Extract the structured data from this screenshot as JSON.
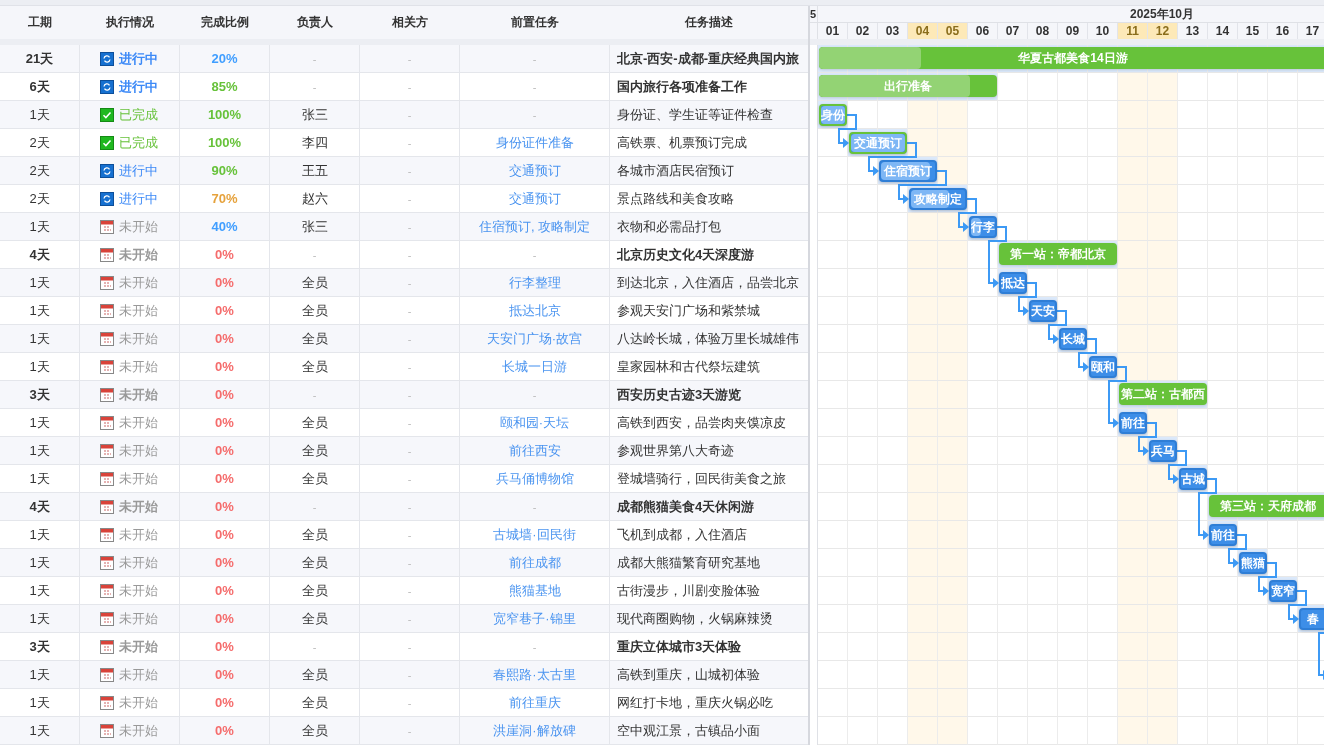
{
  "table": {
    "columns": [
      "工期",
      "执行情况",
      "完成比例",
      "负责人",
      "相关方",
      "前置任务",
      "任务描述"
    ],
    "rows": [
      {
        "kind": "summary",
        "duration": "21天",
        "status": {
          "kind": "in_progress",
          "label": "进行中"
        },
        "progress": {
          "text": "20%",
          "color": "#409eff"
        },
        "owner": "-",
        "stakeholder": "-",
        "predecessor": "-",
        "description": "北京-西安-成都-重庆经典国内旅",
        "bar": {
          "kind": "summary",
          "days": [
            true,
            true,
            true,
            true,
            true,
            true,
            true,
            true,
            true,
            true,
            true,
            true,
            true,
            true,
            true,
            true,
            true
          ],
          "label": "华夏古都美食14日游",
          "level": 0.2
        }
      },
      {
        "kind": "summary",
        "duration": "6天",
        "status": {
          "kind": "in_progress",
          "label": "进行中"
        },
        "progress": {
          "text": "85%",
          "color": "#67c23a"
        },
        "owner": "-",
        "stakeholder": "-",
        "predecessor": "-",
        "description": "国内旅行各项准备工作",
        "bar": {
          "kind": "summary",
          "days": [
            true,
            true,
            true,
            true,
            true,
            true,
            false,
            false,
            false,
            false,
            false,
            false,
            false,
            false,
            false,
            false,
            false
          ],
          "label": "出行准备",
          "level": 0.85
        }
      },
      {
        "kind": "task",
        "duration": "1天",
        "status": {
          "kind": "done",
          "label": "已完成"
        },
        "progress": {
          "text": "100%",
          "color": "#67c23a"
        },
        "owner": "张三",
        "stakeholder": "-",
        "predecessor": "-",
        "description": "身份证、学生证等证件检查",
        "bar": {
          "kind": "task",
          "days": [
            true,
            false,
            false,
            false,
            false,
            false,
            false,
            false,
            false,
            false,
            false,
            false,
            false,
            false,
            false,
            false,
            false
          ],
          "label": "身份",
          "level": 1,
          "linked": false
        }
      },
      {
        "kind": "task",
        "duration": "2天",
        "status": {
          "kind": "done",
          "label": "已完成"
        },
        "progress": {
          "text": "100%",
          "color": "#67c23a"
        },
        "owner": "李四",
        "stakeholder": "-",
        "predecessor": "身份证件准备",
        "description": "高铁票、机票预订完成",
        "bar": {
          "kind": "task",
          "days": [
            false,
            true,
            true,
            false,
            false,
            false,
            false,
            false,
            false,
            false,
            false,
            false,
            false,
            false,
            false,
            false,
            false
          ],
          "label": "交通预订",
          "level": 1,
          "linked": true
        }
      },
      {
        "kind": "task",
        "duration": "2天",
        "status": {
          "kind": "in_progress",
          "label": "进行中"
        },
        "progress": {
          "text": "90%",
          "color": "#67c23a"
        },
        "owner": "王五",
        "stakeholder": "-",
        "predecessor": "交通预订",
        "description": "各城市酒店民宿预订",
        "bar": {
          "kind": "task",
          "days": [
            false,
            false,
            true,
            true,
            false,
            false,
            false,
            false,
            false,
            false,
            false,
            false,
            false,
            false,
            false,
            false,
            false
          ],
          "label": "住宿预订",
          "level": 0.9,
          "linked": true
        }
      },
      {
        "kind": "task",
        "duration": "2天",
        "status": {
          "kind": "in_progress",
          "label": "进行中"
        },
        "progress": {
          "text": "70%",
          "color": "#e6a23c"
        },
        "owner": "赵六",
        "stakeholder": "-",
        "predecessor": "交通预订",
        "description": "景点路线和美食攻略",
        "bar": {
          "kind": "task",
          "days": [
            false,
            false,
            false,
            true,
            true,
            false,
            false,
            false,
            false,
            false,
            false,
            false,
            false,
            false,
            false,
            false,
            false
          ],
          "label": "攻略制定",
          "level": 0.7,
          "linked": true
        }
      },
      {
        "kind": "task",
        "duration": "1天",
        "status": {
          "kind": "not_started",
          "label": "未开始"
        },
        "progress": {
          "text": "40%",
          "color": "#409eff"
        },
        "owner": "张三",
        "stakeholder": "-",
        "predecessor": "住宿预订, 攻略制定",
        "description": "衣物和必需品打包",
        "bar": {
          "kind": "task",
          "days": [
            false,
            false,
            false,
            false,
            false,
            true,
            false,
            false,
            false,
            false,
            false,
            false,
            false,
            false,
            false,
            false,
            false
          ],
          "label": "行李",
          "level": 0.4,
          "linked": true
        }
      },
      {
        "kind": "summary",
        "duration": "4天",
        "status": {
          "kind": "not_started",
          "label": "未开始"
        },
        "progress": {
          "text": "0%",
          "color": "#f56c6c"
        },
        "owner": "-",
        "stakeholder": "-",
        "predecessor": "-",
        "description": "北京历史文化4天深度游",
        "bar": {
          "kind": "summary",
          "days": [
            false,
            false,
            false,
            false,
            false,
            false,
            true,
            true,
            true,
            true,
            false,
            false,
            false,
            false,
            false,
            false,
            false
          ],
          "label": "第一站：帝都北京"
        }
      },
      {
        "kind": "task",
        "duration": "1天",
        "status": {
          "kind": "not_started",
          "label": "未开始"
        },
        "progress": {
          "text": "0%",
          "color": "#f56c6c"
        },
        "owner": "全员",
        "stakeholder": "-",
        "predecessor": "行李整理",
        "description": "到达北京，入住酒店，品尝北京",
        "bar": {
          "kind": "task",
          "days": [
            false,
            false,
            false,
            false,
            false,
            false,
            true,
            false,
            false,
            false,
            false,
            false,
            false,
            false,
            false,
            false,
            false
          ],
          "label": "抵达",
          "linked": true
        }
      },
      {
        "kind": "task",
        "duration": "1天",
        "status": {
          "kind": "not_started",
          "label": "未开始"
        },
        "progress": {
          "text": "0%",
          "color": "#f56c6c"
        },
        "owner": "全员",
        "stakeholder": "-",
        "predecessor": "抵达北京",
        "description": "参观天安门广场和紫禁城",
        "bar": {
          "kind": "task",
          "days": [
            false,
            false,
            false,
            false,
            false,
            false,
            false,
            true,
            false,
            false,
            false,
            false,
            false,
            false,
            false,
            false,
            false
          ],
          "label": "天安",
          "linked": true
        }
      },
      {
        "kind": "task",
        "duration": "1天",
        "status": {
          "kind": "not_started",
          "label": "未开始"
        },
        "progress": {
          "text": "0%",
          "color": "#f56c6c"
        },
        "owner": "全员",
        "stakeholder": "-",
        "predecessor": "天安门广场·故宫",
        "description": "八达岭长城，体验万里长城雄伟",
        "bar": {
          "kind": "task",
          "days": [
            false,
            false,
            false,
            false,
            false,
            false,
            false,
            false,
            true,
            false,
            false,
            false,
            false,
            false,
            false,
            false,
            false
          ],
          "label": "长城",
          "linked": true
        }
      },
      {
        "kind": "task",
        "duration": "1天",
        "status": {
          "kind": "not_started",
          "label": "未开始"
        },
        "progress": {
          "text": "0%",
          "color": "#f56c6c"
        },
        "owner": "全员",
        "stakeholder": "-",
        "predecessor": "长城一日游",
        "description": "皇家园林和古代祭坛建筑",
        "bar": {
          "kind": "task",
          "days": [
            false,
            false,
            false,
            false,
            false,
            false,
            false,
            false,
            false,
            true,
            false,
            false,
            false,
            false,
            false,
            false,
            false
          ],
          "label": "颐和",
          "linked": true
        }
      },
      {
        "kind": "summary",
        "duration": "3天",
        "status": {
          "kind": "not_started",
          "label": "未开始"
        },
        "progress": {
          "text": "0%",
          "color": "#f56c6c"
        },
        "owner": "-",
        "stakeholder": "-",
        "predecessor": "-",
        "description": "西安历史古迹3天游览",
        "bar": {
          "kind": "summary",
          "days": [
            false,
            false,
            false,
            false,
            false,
            false,
            false,
            false,
            false,
            false,
            true,
            true,
            true,
            false,
            false,
            false,
            false
          ],
          "label": "第二站：古都西"
        }
      },
      {
        "kind": "task",
        "duration": "1天",
        "status": {
          "kind": "not_started",
          "label": "未开始"
        },
        "progress": {
          "text": "0%",
          "color": "#f56c6c"
        },
        "owner": "全员",
        "stakeholder": "-",
        "predecessor": "颐和园·天坛",
        "description": "高铁到西安，品尝肉夹馍凉皮",
        "bar": {
          "kind": "task",
          "days": [
            false,
            false,
            false,
            false,
            false,
            false,
            false,
            false,
            false,
            false,
            true,
            false,
            false,
            false,
            false,
            false,
            false
          ],
          "label": "前往",
          "linked": true
        }
      },
      {
        "kind": "task",
        "duration": "1天",
        "status": {
          "kind": "not_started",
          "label": "未开始"
        },
        "progress": {
          "text": "0%",
          "color": "#f56c6c"
        },
        "owner": "全员",
        "stakeholder": "-",
        "predecessor": "前往西安",
        "description": "参观世界第八大奇迹",
        "bar": {
          "kind": "task",
          "days": [
            false,
            false,
            false,
            false,
            false,
            false,
            false,
            false,
            false,
            false,
            false,
            true,
            false,
            false,
            false,
            false,
            false
          ],
          "label": "兵马",
          "linked": true
        }
      },
      {
        "kind": "task",
        "duration": "1天",
        "status": {
          "kind": "not_started",
          "label": "未开始"
        },
        "progress": {
          "text": "0%",
          "color": "#f56c6c"
        },
        "owner": "全员",
        "stakeholder": "-",
        "predecessor": "兵马俑博物馆",
        "description": "登城墙骑行，回民街美食之旅",
        "bar": {
          "kind": "task",
          "days": [
            false,
            false,
            false,
            false,
            false,
            false,
            false,
            false,
            false,
            false,
            false,
            false,
            true,
            false,
            false,
            false,
            false
          ],
          "label": "古城",
          "linked": true
        }
      },
      {
        "kind": "summary",
        "duration": "4天",
        "status": {
          "kind": "not_started",
          "label": "未开始"
        },
        "progress": {
          "text": "0%",
          "color": "#f56c6c"
        },
        "owner": "-",
        "stakeholder": "-",
        "predecessor": "-",
        "description": "成都熊猫美食4天休闲游",
        "bar": {
          "kind": "summary",
          "days": [
            false,
            false,
            false,
            false,
            false,
            false,
            false,
            false,
            false,
            false,
            false,
            false,
            false,
            true,
            true,
            true,
            true
          ],
          "label": "第三站：天府成都"
        }
      },
      {
        "kind": "task",
        "duration": "1天",
        "status": {
          "kind": "not_started",
          "label": "未开始"
        },
        "progress": {
          "text": "0%",
          "color": "#f56c6c"
        },
        "owner": "全员",
        "stakeholder": "-",
        "predecessor": "古城墙·回民街",
        "description": "飞机到成都，入住酒店",
        "bar": {
          "kind": "task",
          "days": [
            false,
            false,
            false,
            false,
            false,
            false,
            false,
            false,
            false,
            false,
            false,
            false,
            false,
            true,
            false,
            false,
            false
          ],
          "label": "前往",
          "linked": true
        }
      },
      {
        "kind": "task",
        "duration": "1天",
        "status": {
          "kind": "not_started",
          "label": "未开始"
        },
        "progress": {
          "text": "0%",
          "color": "#f56c6c"
        },
        "owner": "全员",
        "stakeholder": "-",
        "predecessor": "前往成都",
        "description": "成都大熊猫繁育研究基地",
        "bar": {
          "kind": "task",
          "days": [
            false,
            false,
            false,
            false,
            false,
            false,
            false,
            false,
            false,
            false,
            false,
            false,
            false,
            false,
            true,
            false,
            false
          ],
          "label": "熊猫",
          "linked": true
        }
      },
      {
        "kind": "task",
        "duration": "1天",
        "status": {
          "kind": "not_started",
          "label": "未开始"
        },
        "progress": {
          "text": "0%",
          "color": "#f56c6c"
        },
        "owner": "全员",
        "stakeholder": "-",
        "predecessor": "熊猫基地",
        "description": "古街漫步，川剧变脸体验",
        "bar": {
          "kind": "task",
          "days": [
            false,
            false,
            false,
            false,
            false,
            false,
            false,
            false,
            false,
            false,
            false,
            false,
            false,
            false,
            false,
            true,
            false
          ],
          "label": "宽窄",
          "linked": true
        }
      },
      {
        "kind": "task",
        "duration": "1天",
        "status": {
          "kind": "not_started",
          "label": "未开始"
        },
        "progress": {
          "text": "0%",
          "color": "#f56c6c"
        },
        "owner": "全员",
        "stakeholder": "-",
        "predecessor": "宽窄巷子·锦里",
        "description": "现代商圈购物，火锅麻辣烫",
        "bar": {
          "kind": "task",
          "days": [
            false,
            false,
            false,
            false,
            false,
            false,
            false,
            false,
            false,
            false,
            false,
            false,
            false,
            false,
            false,
            false,
            true
          ],
          "label": "春",
          "linked": true
        }
      },
      {
        "kind": "summary",
        "duration": "3天",
        "status": {
          "kind": "not_started",
          "label": "未开始"
        },
        "progress": {
          "text": "0%",
          "color": "#f56c6c"
        },
        "owner": "-",
        "stakeholder": "-",
        "predecessor": "-",
        "description": "重庆立体城市3天体验"
      },
      {
        "kind": "task",
        "duration": "1天",
        "status": {
          "kind": "not_started",
          "label": "未开始"
        },
        "progress": {
          "text": "0%",
          "color": "#f56c6c"
        },
        "owner": "全员",
        "stakeholder": "-",
        "predecessor": "春熙路·太古里",
        "description": "高铁到重庆，山城初体验",
        "bar": {
          "kind": "task",
          "days": [
            false,
            false,
            false,
            false,
            false,
            false,
            false,
            false,
            false,
            false,
            false,
            false,
            false,
            false,
            false,
            false,
            false
          ],
          "linked": true
        }
      },
      {
        "kind": "task",
        "duration": "1天",
        "status": {
          "kind": "not_started",
          "label": "未开始"
        },
        "progress": {
          "text": "0%",
          "color": "#f56c6c"
        },
        "owner": "全员",
        "stakeholder": "-",
        "predecessor": "前往重庆",
        "description": "网红打卡地，重庆火锅必吃"
      },
      {
        "kind": "task",
        "duration": "1天",
        "status": {
          "kind": "not_started",
          "label": "未开始"
        },
        "progress": {
          "text": "0%",
          "color": "#f56c6c"
        },
        "owner": "全员",
        "stakeholder": "-",
        "predecessor": "洪崖洞·解放碑",
        "description": "空中观江景，古镇品小面"
      }
    ]
  },
  "gantt": {
    "corner_label": "5",
    "month": "2025年10月",
    "days": [
      {
        "label": "01",
        "weekend": false
      },
      {
        "label": "02",
        "weekend": false
      },
      {
        "label": "03",
        "weekend": false
      },
      {
        "label": "04",
        "weekend": true
      },
      {
        "label": "05",
        "weekend": true
      },
      {
        "label": "06",
        "weekend": false
      },
      {
        "label": "07",
        "weekend": false
      },
      {
        "label": "08",
        "weekend": false
      },
      {
        "label": "09",
        "weekend": false
      },
      {
        "label": "10",
        "weekend": false
      },
      {
        "label": "11",
        "weekend": true
      },
      {
        "label": "12",
        "weekend": true
      },
      {
        "label": "13",
        "weekend": false
      },
      {
        "label": "14",
        "weekend": false
      },
      {
        "label": "15",
        "weekend": false
      },
      {
        "label": "16",
        "weekend": false
      },
      {
        "label": "17",
        "weekend": false
      }
    ]
  }
}
